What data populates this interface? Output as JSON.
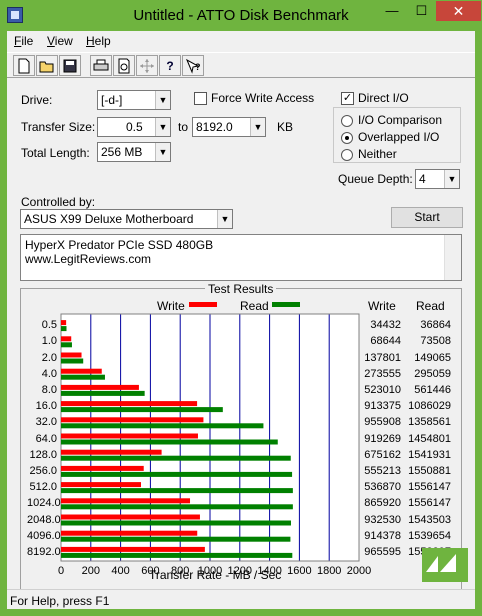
{
  "window": {
    "title": "Untitled - ATTO Disk Benchmark",
    "min": "—",
    "max": "☐",
    "close": "✕"
  },
  "menu": [
    {
      "label": "File",
      "accel": "F",
      "rest": "ile"
    },
    {
      "label": "View",
      "accel": "V",
      "rest": "iew"
    },
    {
      "label": "Help",
      "accel": "H",
      "rest": "elp"
    }
  ],
  "toolbar": [
    "new-file-icon",
    "open-folder-icon",
    "save-icon",
    "print-icon",
    "print-preview-icon",
    "move-icon",
    "help-icon",
    "context-help-icon"
  ],
  "form": {
    "drive_label": "Drive:",
    "drive_value": "[-d-]",
    "force_write_label": "Force Write Access",
    "direct_io_label": "Direct I/O",
    "transfer_size_label": "Transfer Size:",
    "transfer_from": "0.5",
    "to_label": "to",
    "transfer_to": "8192.0",
    "kb_label": "KB",
    "total_length_label": "Total Length:",
    "total_length_value": "256 MB",
    "io_comparison_label": "I/O Comparison",
    "overlapped_io_label": "Overlapped I/O",
    "neither_label": "Neither",
    "queue_depth_label": "Queue Depth:",
    "queue_depth_value": "4",
    "controlled_by_label": "Controlled by:",
    "controlled_by_value": "ASUS X99 Deluxe Motherboard",
    "start_label": "Start",
    "description_line1": "HyperX Predator PCIe SSD 480GB",
    "description_line2": "www.LegitReviews.com"
  },
  "results": {
    "title": "Test Results",
    "write_legend": "Write",
    "read_legend": "Read",
    "write_col": "Write",
    "read_col": "Read",
    "xlabel": "Transfer Rate - MB / Sec"
  },
  "status": "For Help, press F1",
  "colors": {
    "write": "#ff0000",
    "read": "#008000",
    "grid": "#0000a0"
  },
  "chart_data": {
    "type": "bar",
    "orientation": "horizontal",
    "title": "Test Results",
    "xlabel": "Transfer Rate - MB / Sec",
    "xlim": [
      0,
      2000
    ],
    "xticks": [
      "0",
      "200",
      "400",
      "600",
      "800",
      "1000",
      "1200",
      "1400",
      "1600",
      "1800",
      "2000"
    ],
    "categories": [
      "0.5",
      "1.0",
      "2.0",
      "4.0",
      "8.0",
      "16.0",
      "32.0",
      "64.0",
      "128.0",
      "256.0",
      "512.0",
      "1024.0",
      "2048.0",
      "4096.0",
      "8192.0"
    ],
    "series": [
      {
        "name": "Write",
        "color": "#ff0000",
        "values_kb": [
          34432,
          68644,
          137801,
          273555,
          523010,
          913375,
          955908,
          919269,
          675162,
          555213,
          536870,
          865920,
          932530,
          914378,
          965595
        ],
        "labels": [
          "34432",
          "68644",
          "137801",
          "273555",
          "523010",
          "913375",
          "955908",
          "919269",
          "675162",
          "555213",
          "536870",
          "865920",
          "932530",
          "914378",
          "965595"
        ]
      },
      {
        "name": "Read",
        "color": "#008000",
        "values_kb": [
          36864,
          73508,
          149065,
          295059,
          561446,
          1086029,
          1358561,
          1454801,
          1541931,
          1550881,
          1556147,
          1556147,
          1543503,
          1539654,
          1552397
        ],
        "labels": [
          "36864",
          "73508",
          "149065",
          "295059",
          "561446",
          "1086029",
          "1358561",
          "1454801",
          "1541931",
          "1550881",
          "1556147",
          "1556147",
          "1543503",
          "1539654",
          "1552397"
        ]
      }
    ]
  }
}
